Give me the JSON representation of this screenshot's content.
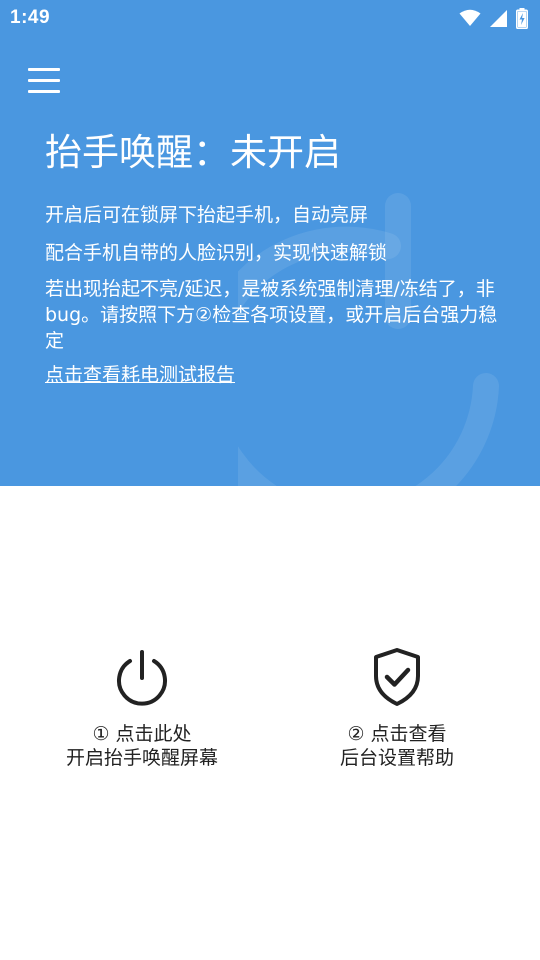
{
  "status_bar": {
    "time": "1:49",
    "icons": [
      "wifi-icon",
      "signal-icon",
      "battery-charging-icon"
    ]
  },
  "header": {
    "background_color": "#4a97e0",
    "menu_icon": "hamburger-menu-icon",
    "title": "抬手唤醒：未开启",
    "description_lines": [
      "开启后可在锁屏下抬起手机，自动亮屏",
      "配合手机自带的人脸识别，实现快速解锁",
      "若出现抬起不亮/延迟，是被系统强制清理/冻结了，非bug。请按照下方②检查各项设置，或开启后台强力稳定"
    ],
    "report_link": "点击查看耗电测试报告"
  },
  "actions": [
    {
      "icon": "power-icon",
      "line1": "① 点击此处",
      "line2": "开启抬手唤醒屏幕"
    },
    {
      "icon": "shield-check-icon",
      "line1": "② 点击查看",
      "line2": "后台设置帮助"
    }
  ]
}
